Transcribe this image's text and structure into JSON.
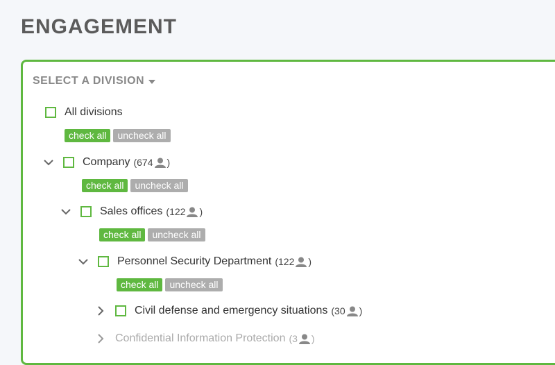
{
  "page": {
    "title": "ENGAGEMENT"
  },
  "panel": {
    "select_label": "SELECT A DIVISION"
  },
  "buttons": {
    "check_all": "check all",
    "uncheck_all": "uncheck all"
  },
  "tree": {
    "all": {
      "label": "All divisions"
    },
    "company": {
      "label": "Company",
      "count_open": "(674",
      "count_close": ")"
    },
    "sales": {
      "label": "Sales offices",
      "count_open": "(122",
      "count_close": ")"
    },
    "personnel": {
      "label": "Personnel Security Department",
      "count_open": "(122",
      "count_close": ")"
    },
    "civil": {
      "label": "Civil defense and emergency situations",
      "count_open": "(30",
      "count_close": ")"
    },
    "confidential": {
      "label": "Confidential Information Protection",
      "count_open": "(3",
      "count_close": ")"
    }
  },
  "colors": {
    "accent": "#5fb840",
    "muted_button": "#adadad",
    "title": "#5b5b5b"
  },
  "icons": {
    "expand_open": "chevron-down-icon",
    "expand_closed": "chevron-right-icon",
    "users": "person-icon"
  }
}
